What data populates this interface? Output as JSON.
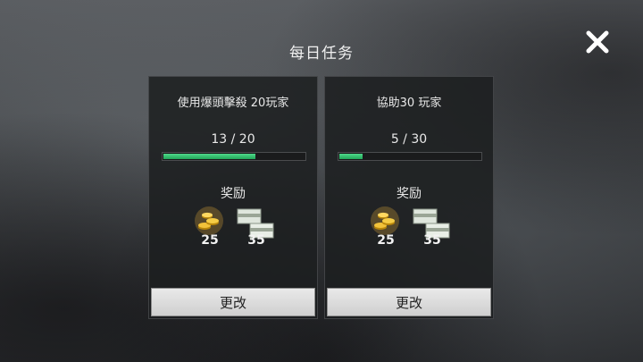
{
  "dialog": {
    "title": "每日任务",
    "close_icon": "close-icon"
  },
  "missions": [
    {
      "description": "使用爆頭擊殺 20玩家",
      "progress_text": "13 / 20",
      "progress": 0.65,
      "reward_label": "奖励",
      "rewards": [
        {
          "icon": "gold-coins-icon",
          "value": "25"
        },
        {
          "icon": "cash-stack-icon",
          "value": "35"
        }
      ],
      "button_label": "更改"
    },
    {
      "description": "協助30 玩家",
      "progress_text": "5 / 30",
      "progress": 0.1667,
      "reward_label": "奖励",
      "rewards": [
        {
          "icon": "gold-coins-icon",
          "value": "25"
        },
        {
          "icon": "cash-stack-icon",
          "value": "35"
        }
      ],
      "button_label": "更改"
    }
  ],
  "colors": {
    "progress_fill": "#2fbf6a",
    "button_bg": "#dcdcdc"
  }
}
